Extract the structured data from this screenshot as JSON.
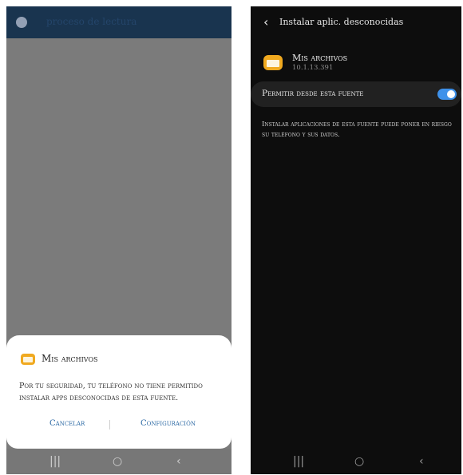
{
  "left_screen": {
    "app_title": "proceso de lectura",
    "dialog": {
      "title": "Mis archivos",
      "message": "Por tu seguridad, tu teléfono no tiene permitido instalar apps desconocidas de esta fuente.",
      "cancel_label": "Cancelar",
      "config_label": "Configuración"
    },
    "nav": {
      "recents": "|||",
      "home": "○",
      "back": "‹"
    }
  },
  "right_screen": {
    "header": {
      "back_glyph": "‹",
      "title": "Instalar aplic. desconocidas"
    },
    "app": {
      "name": "Mis archivos",
      "version": "10.1.13.391"
    },
    "toggle": {
      "label": "Permitir desde esta fuente",
      "on": true
    },
    "description": "Instalar aplicaciones de esta fuente puede poner en riesgo su teléfono y sus datos.",
    "nav": {
      "recents": "|||",
      "home": "○",
      "back": "‹"
    }
  },
  "colors": {
    "accent_blue": "#3e91ea",
    "folder_orange": "#f0a91f",
    "appbar_navy": "#19344f",
    "dim_overlay": "#7b7b7b",
    "dark_bg": "#0d0d0d"
  },
  "icons": {
    "app_icon": "folder-icon",
    "back": "chevron-left-icon",
    "recents": "recents-icon",
    "home": "home-icon"
  }
}
